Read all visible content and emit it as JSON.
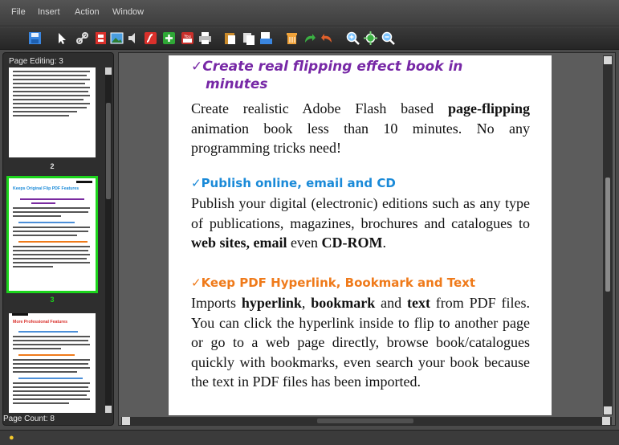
{
  "menu": {
    "file": "File",
    "insert": "Insert",
    "action": "Action",
    "window": "Window"
  },
  "toolbar": {
    "icons": [
      "save-icon",
      "cursor-icon",
      "link-icon",
      "video-icon",
      "image-icon",
      "sound-icon",
      "flash-icon",
      "add-icon",
      "youtube-icon",
      "print-icon",
      "paste-icon",
      "copy-icon",
      "export-icon",
      "delete-icon",
      "redo-icon",
      "undo-icon",
      "zoom-in-icon",
      "fit-icon",
      "zoom-out-icon"
    ]
  },
  "left_panel": {
    "page_editing": "Page Editing: 3",
    "page_count": "Page Count: 8",
    "thumbnails": [
      {
        "page": "2"
      },
      {
        "page": "3",
        "title": "Keeps Original Flip PDF Features",
        "selected": true
      },
      {
        "title": "More Professional Features"
      }
    ]
  },
  "page": {
    "sections": [
      {
        "heading_line1": "✓Create  real  flipping  effect  book  in",
        "heading_line2": "minutes",
        "body_a": "Create realistic Adobe Flash based ",
        "body_b": "page-flipping",
        "body_c": " animation book less than 10 minutes. No any programming tricks need!"
      },
      {
        "heading": "✓Publish online, email and CD",
        "body_a": "Publish your digital (electronic) editions such as any type of publications, magazines, brochures and catalogues to ",
        "body_b": "web sites, email",
        "body_c": " even ",
        "body_d": "CD-ROM",
        "body_e": "."
      },
      {
        "heading": "✓Keep PDF Hyperlink, Bookmark and Text",
        "body_a": "Imports ",
        "body_b": "hyperlink",
        "body_c": ", ",
        "body_d": "bookmark",
        "body_e": " and ",
        "body_f": "text",
        "body_g": " from PDF files. You can click the hyperlink inside to flip to another page or go to a web page directly, browse book/catalogues quickly with bookmarks, even search your book because the text in PDF files has been imported."
      }
    ]
  },
  "colors": {
    "accent_green": "#1cd41c",
    "heading_purple": "#7728a6",
    "heading_blue": "#1a8ad8",
    "heading_orange": "#ef7a1a"
  }
}
